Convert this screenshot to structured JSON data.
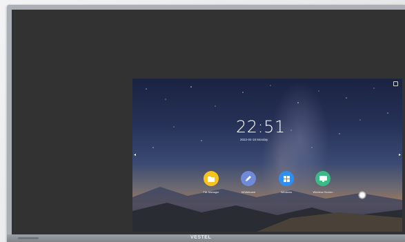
{
  "screen": {
    "time": "22:51",
    "date_line": "2022-04-18   Monday"
  },
  "dock": [
    {
      "label": "File Manager",
      "icon": "folder-icon",
      "color": "#f5c320"
    },
    {
      "label": "Whiteboard",
      "icon": "pencil-icon",
      "color": "#6f8ad8"
    },
    {
      "label": "Windows",
      "icon": "windows-icon",
      "color": "#2f8ff0"
    },
    {
      "label": "Wireless Screen",
      "icon": "cast-icon",
      "color": "#3cba86"
    }
  ],
  "device": {
    "brand": "VESTEL"
  },
  "colors": {
    "panel": "#323232",
    "bezel": "#aab0b5"
  }
}
